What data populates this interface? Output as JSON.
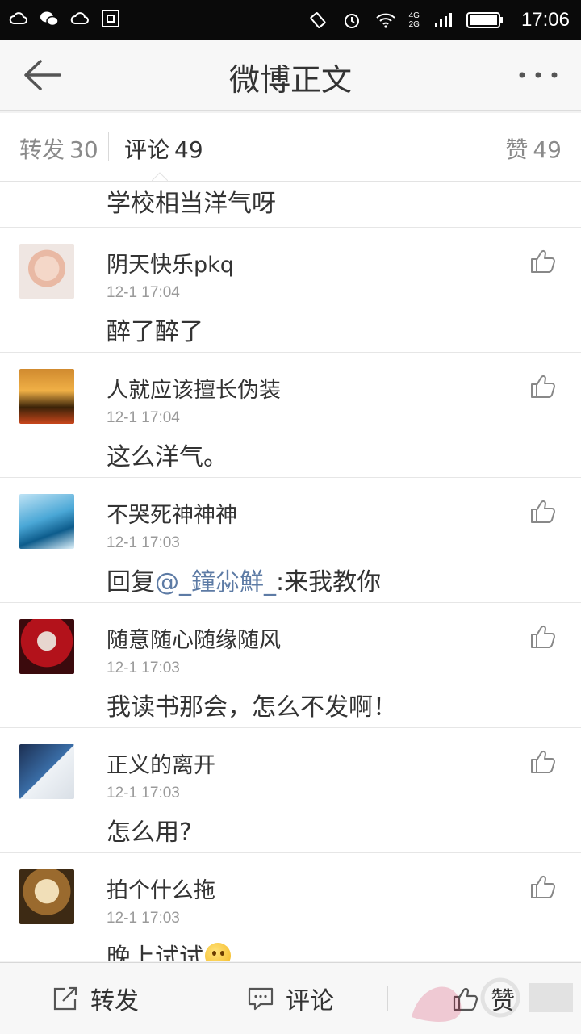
{
  "status_bar": {
    "time": "17:06",
    "net_top": "4G",
    "net_bottom": "2G"
  },
  "header": {
    "title": "微博正文"
  },
  "tabs": {
    "repost": {
      "label": "转发",
      "count": "30"
    },
    "comment": {
      "label": "评论",
      "count": "49"
    },
    "like": {
      "label": "赞",
      "count": "49"
    }
  },
  "top_snippet": "学校相当洋气呀",
  "comments": [
    {
      "name": "阴天快乐pkq",
      "time": "12-1 17:04",
      "text": "醉了醉了"
    },
    {
      "name": "人就应该擅长伪装",
      "time": "12-1 17:04",
      "text": "这么洋气。"
    },
    {
      "name": "不哭死神神神",
      "time": "12-1 17:03",
      "text_prefix": "回复",
      "mention": "@_鐘尛鮮_",
      "text_suffix": ":来我教你"
    },
    {
      "name": "随意随心随缘随风",
      "time": "12-1 17:03",
      "text": "我读书那会，怎么不发啊！"
    },
    {
      "name": "正义的离开",
      "time": "12-1 17:03",
      "text": "怎么用?"
    },
    {
      "name": "拍个什么拖",
      "time": "12-1 17:03",
      "text": "晚上试试"
    }
  ],
  "bottom_bar": {
    "repost": "转发",
    "comment": "评论",
    "like": "赞"
  },
  "colors": {
    "mention": "#5d7ba5",
    "status_bar": "#0a0a0a",
    "background": "#f2f2f2"
  }
}
